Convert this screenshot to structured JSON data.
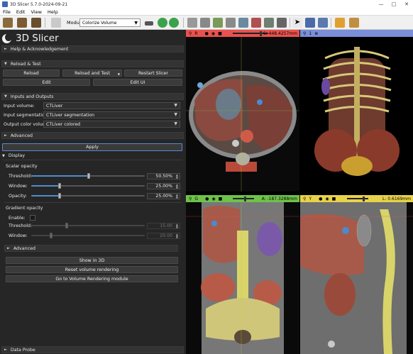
{
  "window": {
    "title": "3D Slicer 5.7.0-2024-09-21"
  },
  "menu": [
    "File",
    "Edit",
    "View",
    "Help"
  ],
  "toolbar": {
    "modules_label": "Modules:",
    "module_selected": "Colorize Volume"
  },
  "app": {
    "logo_text": "3D Slicer"
  },
  "sections": {
    "help": "Help & Acknowledgement",
    "reload": "Reload & Test",
    "io": "Inputs and Outputs",
    "advanced": "Advanced",
    "display": "Display",
    "scalar_opacity": "Scalar opacity",
    "gradient_opacity": "Gradient opacity",
    "advanced2": "Advanced",
    "data_probe": "Data Probe"
  },
  "reload_buttons": {
    "reload": "Reload",
    "reload_test": "Reload and Test",
    "restart": "Restart Slicer",
    "edit": "Edit",
    "edit_ui": "Edit UI"
  },
  "inputs": {
    "input_volume_label": "Input volume:",
    "input_volume": "CTLiver",
    "input_segmentation_label": "Input segmentation:",
    "input_segmentation": "CTLiver segmentation",
    "output_volume_label": "Output color volume:",
    "output_volume": "CTLiver colored"
  },
  "apply_label": "Apply",
  "scalar": {
    "threshold_label": "Threshold:",
    "threshold_value": "50.50%",
    "threshold": 0.505,
    "window_label": "Window:",
    "window_value": "25.00%",
    "window": 0.25,
    "opacity_label": "Opacity:",
    "opacity_value": "25.00%",
    "opacity": 0.25
  },
  "gradient": {
    "enable_label": "Enable:",
    "threshold_label": "Threshold:",
    "threshold_value": "15.00",
    "window_label": "Window:",
    "window_value": "20.00"
  },
  "bottom_buttons": {
    "show3d": "Show in 3D",
    "reset": "Reset volume rendering",
    "goto": "Go to Volume Rendering module"
  },
  "views": {
    "red": {
      "letter": "R",
      "readout": "S: 448.4257mm",
      "color": "#e8524e"
    },
    "threed": {
      "letter": "1",
      "color": "#7a8fd8"
    },
    "green": {
      "letter": "G",
      "readout": "A: -187.3288mm",
      "color": "#6ec24a"
    },
    "yellow": {
      "letter": "Y",
      "readout": "L: 0.6169mm",
      "color": "#e8d24a"
    }
  }
}
